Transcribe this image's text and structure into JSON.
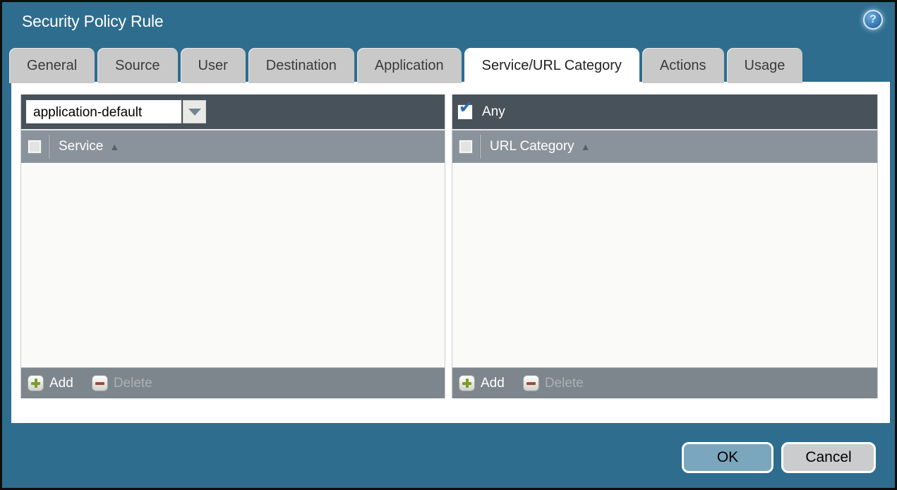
{
  "window": {
    "title": "Security Policy Rule"
  },
  "icons": {
    "help_glyph": "?",
    "check_glyph": "✔",
    "sort_asc_glyph": "▲"
  },
  "tabs": [
    {
      "label": "General",
      "active": false
    },
    {
      "label": "Source",
      "active": false
    },
    {
      "label": "User",
      "active": false
    },
    {
      "label": "Destination",
      "active": false
    },
    {
      "label": "Application",
      "active": false
    },
    {
      "label": "Service/URL Category",
      "active": true
    },
    {
      "label": "Actions",
      "active": false
    },
    {
      "label": "Usage",
      "active": false
    }
  ],
  "service_panel": {
    "dropdown_value": "application-default",
    "column_header": "Service",
    "rows": [],
    "add_label": "Add",
    "delete_label": "Delete",
    "delete_enabled": false
  },
  "url_category_panel": {
    "any_label": "Any",
    "any_checked": true,
    "column_header": "URL Category",
    "rows": [],
    "add_label": "Add",
    "delete_label": "Delete",
    "delete_enabled": false
  },
  "buttons": {
    "ok_label": "OK",
    "cancel_label": "Cancel"
  },
  "colors": {
    "background_teal": "#2E6D8E",
    "panel_header_dark": "#47525A",
    "column_header_gray": "#8A939B",
    "footer_gray": "#7D868D",
    "tab_gray": "#C9C9C9",
    "active_tab_white": "#FFFFFF",
    "ok_button_blue": "#7AA7BD",
    "cancel_button_gray": "#CACCCD",
    "add_plus_green": "#7E9C26",
    "delete_minus_red": "#9C4A38",
    "check_blue": "#2C6CA8"
  }
}
